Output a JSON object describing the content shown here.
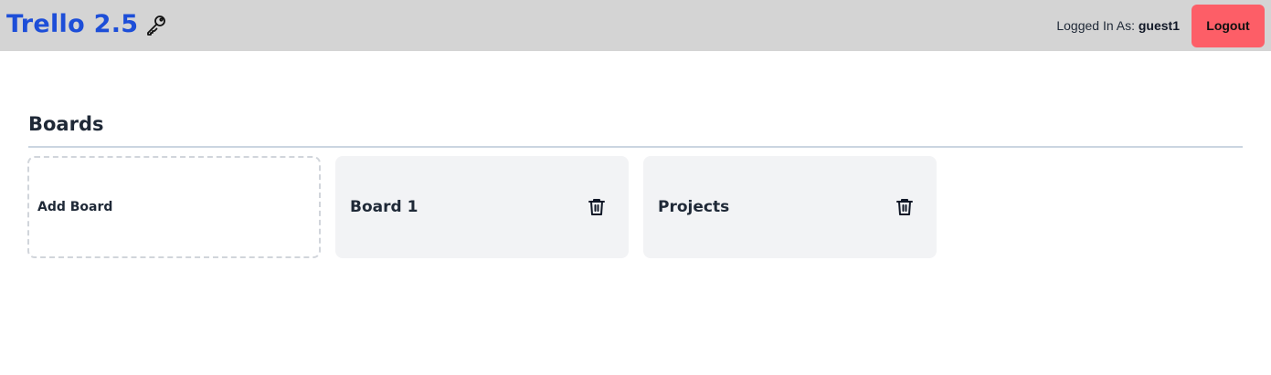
{
  "header": {
    "app_title": "Trello 2.5",
    "logo_icon": "key-icon",
    "logged_in_label": "Logged In As:",
    "username": "guest1",
    "logout_label": "Logout",
    "colors": {
      "bar_background": "#d4d4d4",
      "title": "#1d4ed8",
      "logout_button": "#fd5e67"
    }
  },
  "main": {
    "section_title": "Boards",
    "add_board_label": "Add Board",
    "boards": [
      {
        "name": "Board 1",
        "action_icon": "trash-icon"
      },
      {
        "name": "Projects",
        "action_icon": "trash-icon"
      }
    ]
  }
}
